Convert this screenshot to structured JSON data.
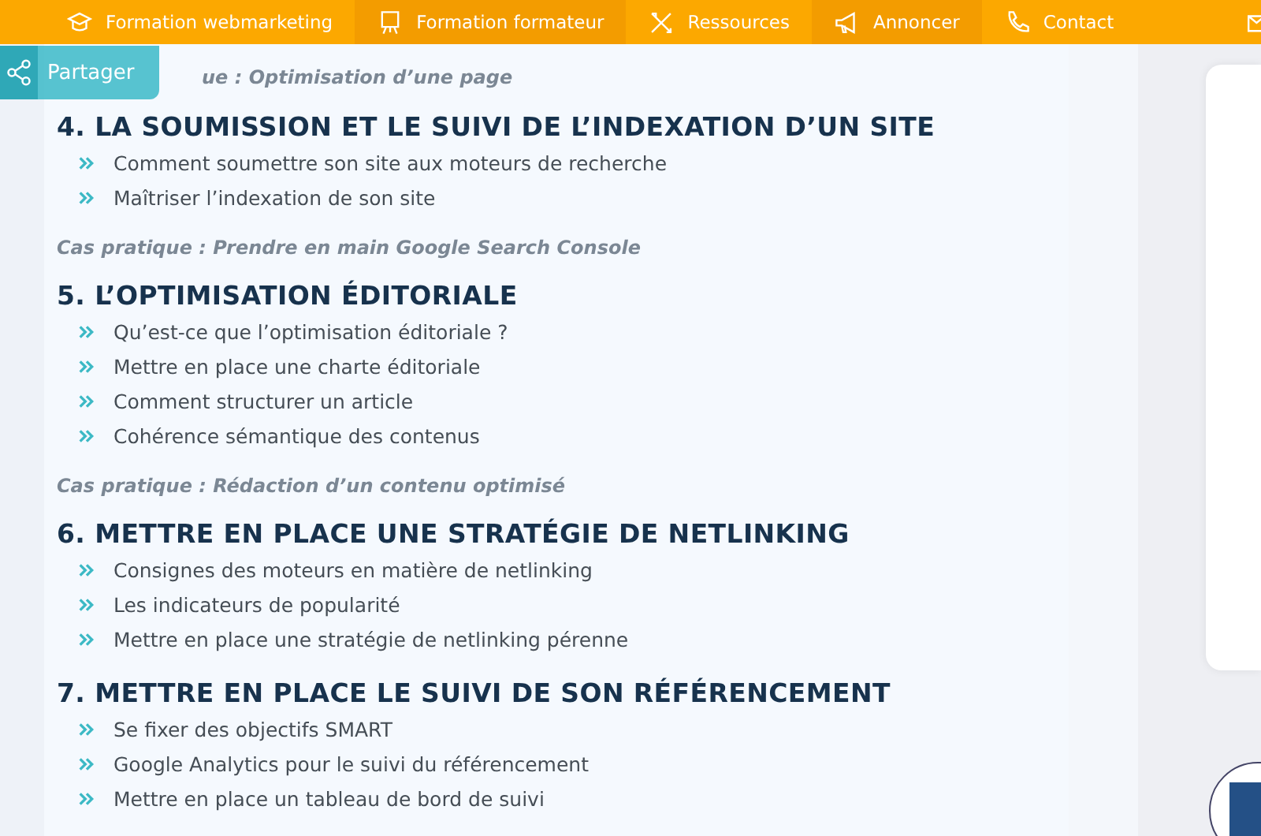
{
  "nav": [
    {
      "label": "Formation webmarketing"
    },
    {
      "label": "Formation formateur"
    },
    {
      "label": "Ressources"
    },
    {
      "label": "Annoncer"
    },
    {
      "label": "Contact"
    }
  ],
  "share": {
    "label": "Partager"
  },
  "top_case": "ue : Optimisation d’une page",
  "sections": [
    {
      "title": "4. LA SOUMISSION ET LE SUIVI DE L’INDEXATION D’UN SITE",
      "items": [
        "Comment soumettre son site aux moteurs de recherche",
        "Maîtriser l’indexation de son site"
      ],
      "case": "Cas pratique : Prendre en main Google Search Console"
    },
    {
      "title": "5. L’OPTIMISATION ÉDITORIALE",
      "items": [
        "Qu’est-ce que l’optimisation éditoriale ?",
        "Mettre en place une charte éditoriale",
        "Comment structurer un article",
        "Cohérence sémantique des contenus"
      ],
      "case": "Cas pratique : Rédaction d’un contenu optimisé"
    },
    {
      "title": "6. METTRE EN PLACE UNE STRATÉGIE DE NETLINKING",
      "items": [
        "Consignes des moteurs en matière de netlinking",
        "Les indicateurs de popularité",
        "Mettre en place une stratégie de netlinking pérenne"
      ]
    },
    {
      "title": "7. METTRE EN PLACE LE SUIVI DE SON RÉFÉRENCEMENT",
      "items": [
        "Se fixer des objectifs SMART",
        "Google Analytics pour le suivi du référencement",
        "Mettre en place un tableau de bord de suivi"
      ]
    }
  ]
}
